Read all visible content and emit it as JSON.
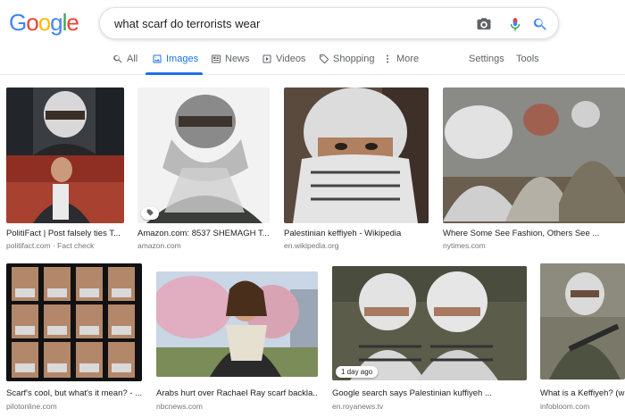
{
  "logo": {
    "letters": [
      "G",
      "o",
      "o",
      "g",
      "l",
      "e"
    ],
    "colors": [
      "#4285F4",
      "#EA4335",
      "#FBBC05",
      "#4285F4",
      "#34A853",
      "#EA4335"
    ]
  },
  "search": {
    "query": "what scarf do terrorists wear"
  },
  "tabs": {
    "all": "All",
    "images": "Images",
    "news": "News",
    "videos": "Videos",
    "shopping": "Shopping",
    "more": "More",
    "settings": "Settings",
    "tools": "Tools"
  },
  "accent_color": "#1a73e8",
  "results": [
    {
      "caption": "PolitiFact | Post falsely ties T...",
      "source": "politifact.com · Fact check"
    },
    {
      "caption": "Amazon.com: 8537 SHEMAGH T...",
      "source": "amazon.com"
    },
    {
      "caption": "Palestinian keffiyeh - Wikipedia",
      "source": "en.wikipedia.org"
    },
    {
      "caption": "Where Some See Fashion, Others See ...",
      "source": "nytimes.com"
    },
    {
      "caption": "Scarf's cool, but what's it mean? - ...",
      "source": "pilotonline.com"
    },
    {
      "caption": "Arabs hurt over Rachael Ray scarf backla...",
      "source": "nbcnews.com"
    },
    {
      "caption": "Google search says Palestinian kuffiyeh ...",
      "source": "en.royanews.tv",
      "badge": "1 day ago"
    },
    {
      "caption": "What is a Keffiyeh? (wi",
      "source": "infobloom.com"
    }
  ]
}
